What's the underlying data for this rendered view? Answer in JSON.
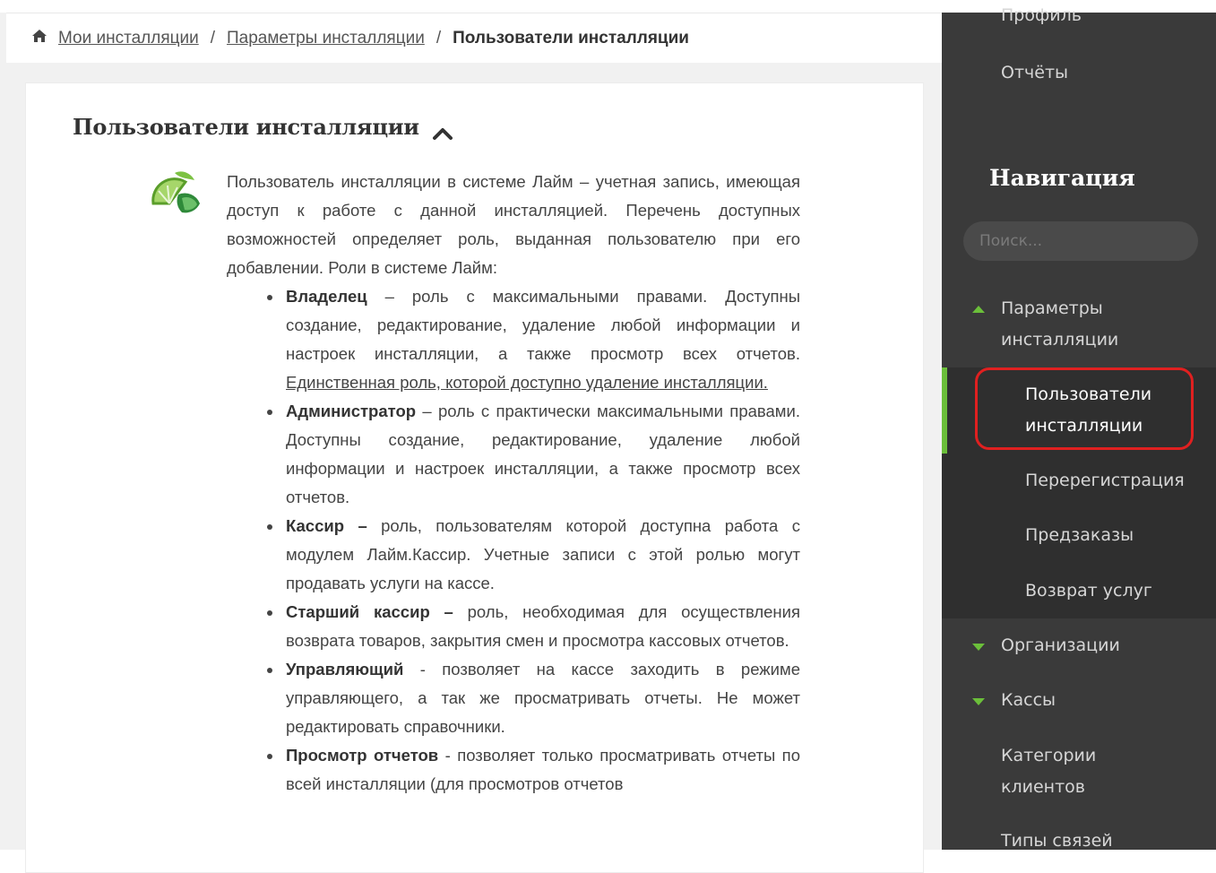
{
  "breadcrumb": {
    "items": [
      "Мои инсталляции",
      "Параметры инсталляции"
    ],
    "separator": "/",
    "current": "Пользователи инсталляции"
  },
  "card": {
    "title": "Пользователи инсталляции",
    "intro": "Пользователь инсталляции в системе Лайм – учетная запись, имеющая доступ к работе с данной инсталляцией. Перечень доступных возможностей определяет роль, выданная пользователю при его добавлении. Роли в системе Лайм:",
    "roles": [
      {
        "name": "Владелец",
        "desc": " – роль с максимальными правами. Доступны создание, редактирование, удаление любой информации и настроек инсталляции, а также просмотр всех отчетов. ",
        "note": "Единственная роль, которой доступно удаление инсталляции."
      },
      {
        "name": "Администратор",
        "desc": " – роль с практически максимальными правами. Доступны создание, редактирование, удаление любой информации и настроек инсталляции, а также просмотр всех отчетов."
      },
      {
        "name": "Кассир –",
        "desc": " роль, пользователям которой доступна работа с модулем Лайм.Кассир. Учетные записи с этой ролью могут продавать услуги на кассе."
      },
      {
        "name": "Старший кассир –",
        "desc": " роль, необходимая для осуществления возврата товаров, закрытия смен и просмотра кассовых отчетов."
      },
      {
        "name": "Управляющий",
        "desc": " - позволяет на кассе заходить в режиме управляющего, а так же просматривать отчеты. Не может редактировать справочники."
      },
      {
        "name": "Просмотр отчетов",
        "desc": " - позволяет только просматривать отчеты по всей инсталляции (для просмотров отчетов"
      }
    ]
  },
  "sidebar": {
    "profile": "Профиль",
    "reports": "Отчёты",
    "nav_title": "Навигация",
    "search_placeholder": "Поиск...",
    "params": "Параметры инсталляции",
    "sub_active": "Пользователи инсталляции",
    "sub_items": [
      "Перерегистрация",
      "Предзаказы",
      "Возврат услуг"
    ],
    "organizations": "Организации",
    "cashboxes": "Кассы",
    "client_categories": "Категории клиентов",
    "link_types": "Типы связей"
  },
  "colors": {
    "accent_green": "#6bbf3a",
    "highlight_red": "#e02020",
    "sidebar_bg": "#3a3a3a"
  },
  "icons": [
    "home-icon",
    "chevron-up-icon",
    "lime-logo-icon",
    "triangle-up-icon",
    "triangle-down-icon"
  ]
}
